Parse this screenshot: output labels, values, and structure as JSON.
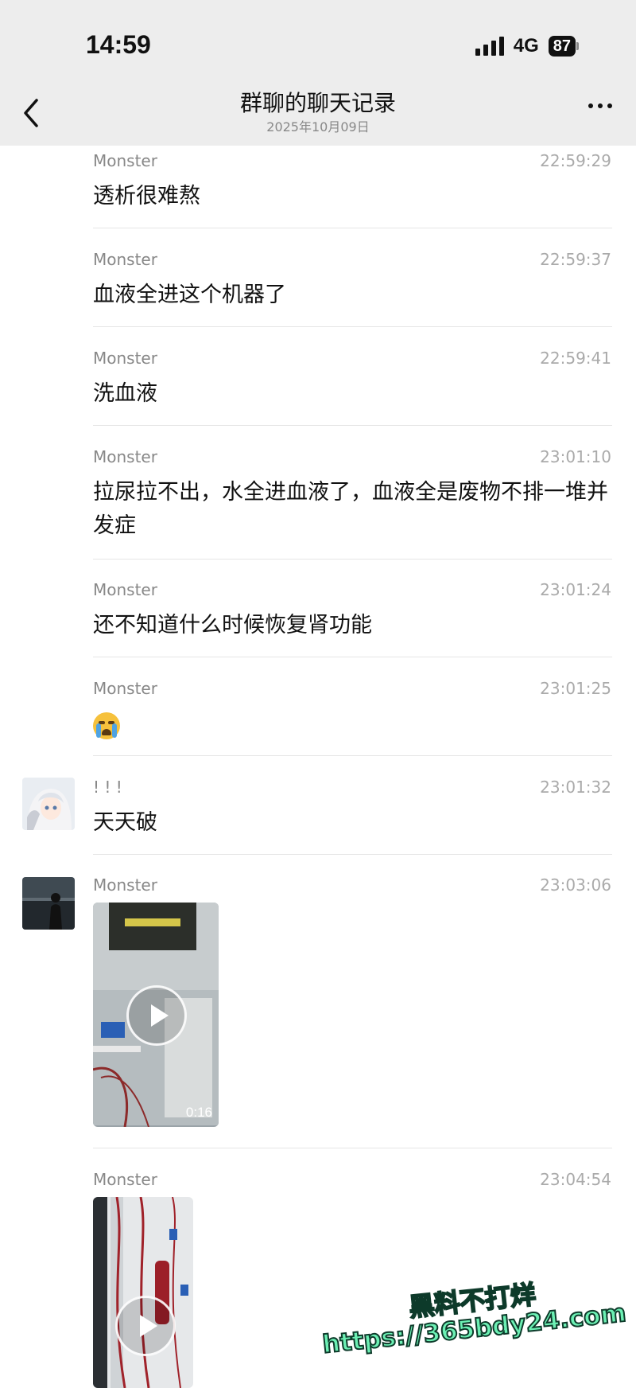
{
  "status_bar": {
    "time": "14:59",
    "network": "4G",
    "battery": "87"
  },
  "header": {
    "title": "群聊的聊天记录",
    "subtitle": "2025年10月09日"
  },
  "messages": [
    {
      "sender": "Monster",
      "time": "22:59:29",
      "text": "透析很难熬"
    },
    {
      "sender": "Monster",
      "time": "22:59:37",
      "text": "血液全进这个机器了"
    },
    {
      "sender": "Monster",
      "time": "22:59:41",
      "text": "洗血液"
    },
    {
      "sender": "Monster",
      "time": "23:01:10",
      "text": "拉尿拉不出，水全进血液了，血液全是废物不排一堆并发症"
    },
    {
      "sender": "Monster",
      "time": "23:01:24",
      "text": "还不知道什么时候恢复肾功能"
    },
    {
      "sender": "Monster",
      "time": "23:01:25",
      "emoji": "loudly-crying-face"
    },
    {
      "sender": "! ! !",
      "time": "23:01:32",
      "text": "天天破"
    },
    {
      "sender": "Monster",
      "time": "23:03:06",
      "video_duration": "0:16"
    },
    {
      "sender": "Monster",
      "time": "23:04:54"
    }
  ],
  "watermark": {
    "line1": "黑料不打烊",
    "line2": "https://365bdy24.com"
  }
}
